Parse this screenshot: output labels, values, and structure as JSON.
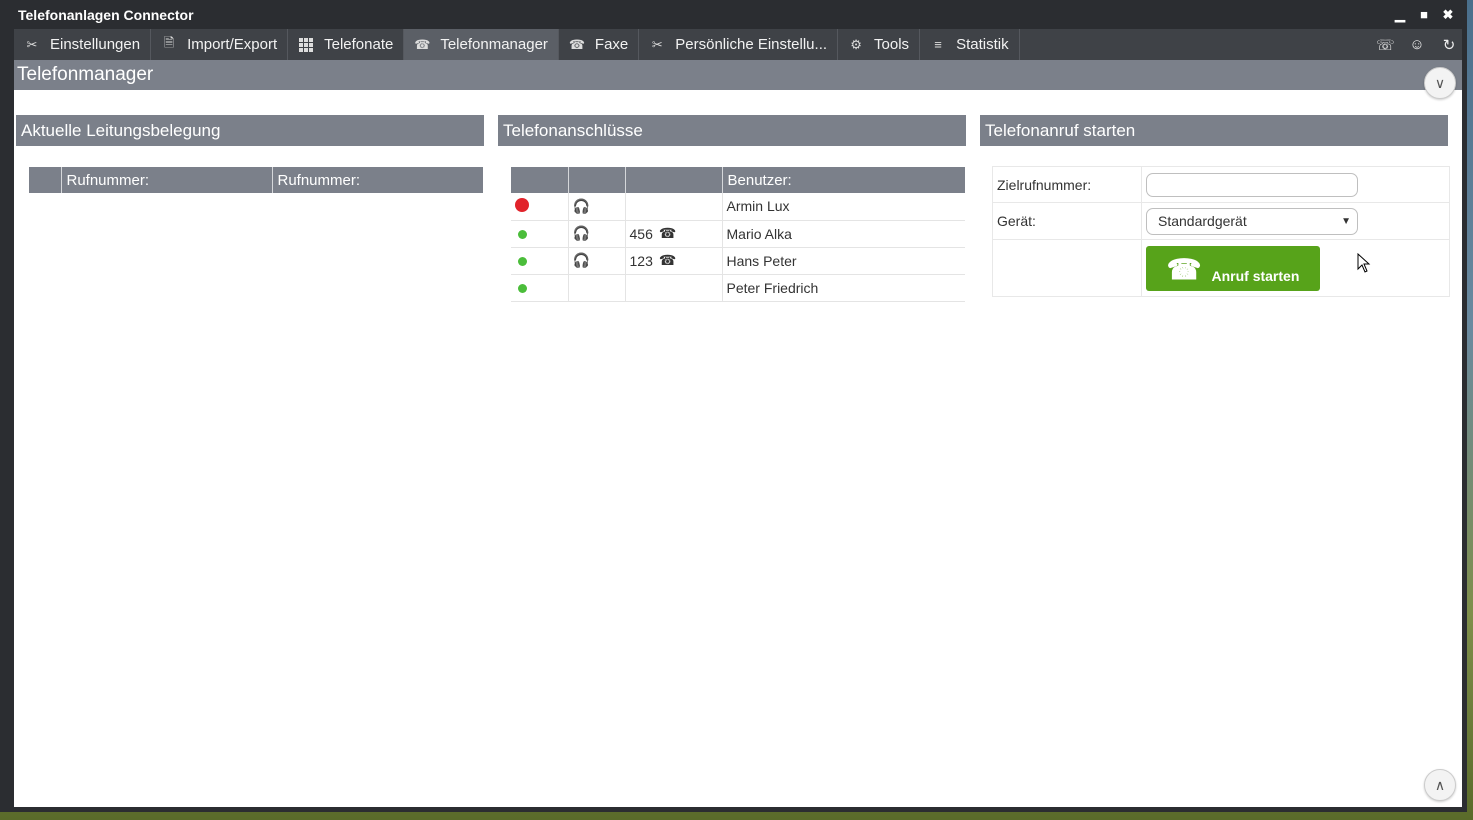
{
  "window": {
    "title": "Telefonanlagen Connector",
    "controls": [
      "minimize-icon",
      "maximize-icon",
      "close-icon"
    ]
  },
  "nav": {
    "items": [
      {
        "label": "Einstellungen",
        "icon": "wrench-icon"
      },
      {
        "label": "Import/Export",
        "icon": "document-icon"
      },
      {
        "label": "Telefonate",
        "icon": "grid-icon"
      },
      {
        "label": "Telefonmanager",
        "icon": "phone-icon",
        "active": true
      },
      {
        "label": "Faxe",
        "icon": "phone-icon"
      },
      {
        "label": "Persönliche Einstellu...",
        "icon": "wrench-icon"
      },
      {
        "label": "Tools",
        "icon": "tools-icon"
      },
      {
        "label": "Statistik",
        "icon": "chart-icon"
      }
    ],
    "right_icons": [
      "phone-user-icon",
      "contact-icon",
      "refresh-icon"
    ]
  },
  "page": {
    "title": "Telefonmanager"
  },
  "lines_panel": {
    "title": "Aktuelle Leitungsbelegung",
    "headers": [
      "",
      "Rufnummer:",
      "Rufnummer:"
    ]
  },
  "ports_panel": {
    "title": "Telefonanschlüsse",
    "headers": [
      "",
      "",
      "",
      "Benutzer:"
    ],
    "rows": [
      {
        "status": "busy",
        "device": true,
        "ext": "",
        "user": "Armin Lux"
      },
      {
        "status": "online",
        "device": true,
        "ext": "456",
        "user": "Mario Alka"
      },
      {
        "status": "online",
        "device": true,
        "ext": "123",
        "user": "Hans Peter"
      },
      {
        "status": "online",
        "device": false,
        "ext": "",
        "user": "Peter Friedrich"
      }
    ]
  },
  "call_panel": {
    "title": "Telefonanruf starten",
    "target_label": "Zielrufnummer:",
    "target_value": "",
    "device_label": "Gerät:",
    "device_value": "Standardgerät",
    "button_label": "Anruf starten"
  },
  "colors": {
    "header": "#7b808a",
    "busy": "#e1232b",
    "online": "#4bbd3a",
    "button": "#57a31a"
  }
}
